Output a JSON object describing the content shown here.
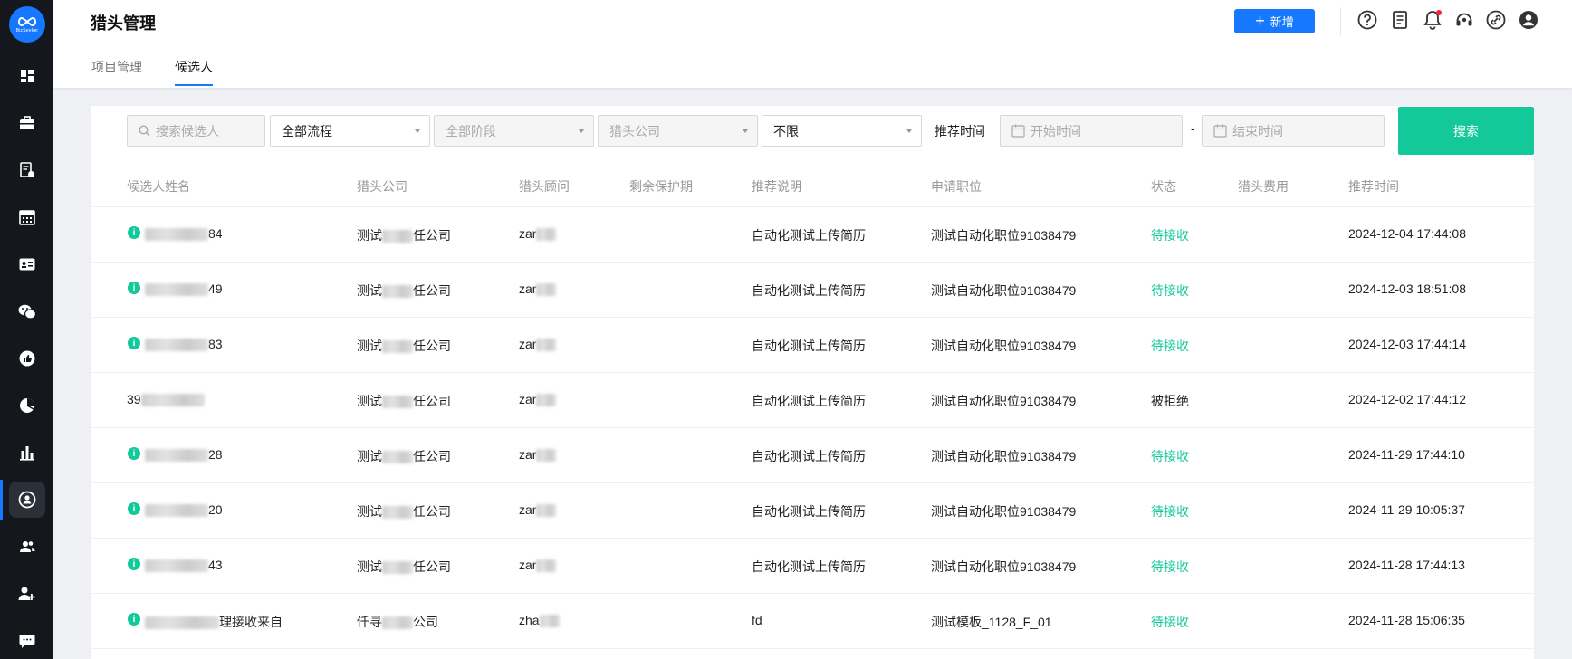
{
  "app": {
    "logo_text": "BizSeeker"
  },
  "header": {
    "title": "猎头管理",
    "add_label": "新增"
  },
  "tabs": [
    {
      "label": "项目管理",
      "active": false
    },
    {
      "label": "候选人",
      "active": true
    }
  ],
  "filters": {
    "search_placeholder": "搜索候选人",
    "process_value": "全部流程",
    "stage_placeholder": "全部阶段",
    "company_placeholder": "猎头公司",
    "limit_value": "不限",
    "time_label": "推荐时间",
    "start_placeholder": "开始时间",
    "dash": "-",
    "end_placeholder": "结束时间",
    "search_button": "搜索"
  },
  "table": {
    "columns": [
      "候选人姓名",
      "猎头公司",
      "猎头顾问",
      "剩余保护期",
      "推荐说明",
      "申请职位",
      "状态",
      "猎头费用",
      "推荐时间"
    ],
    "rows": [
      {
        "has_info": true,
        "name_suffix": "84",
        "company_pre": "测试",
        "company_post": "任公司",
        "consultant": "zar",
        "note": "自动化测试上传简历",
        "position": "测试自动化职位91038479",
        "status": "待接收",
        "fee": "",
        "time": "2024-12-04 17:44:08"
      },
      {
        "has_info": true,
        "name_suffix": "49",
        "company_pre": "测试",
        "company_post": "任公司",
        "consultant": "zar",
        "note": "自动化测试上传简历",
        "position": "测试自动化职位91038479",
        "status": "待接收",
        "fee": "",
        "time": "2024-12-03 18:51:08"
      },
      {
        "has_info": true,
        "name_suffix": "83",
        "company_pre": "测试",
        "company_post": "任公司",
        "consultant": "zar",
        "note": "自动化测试上传简历",
        "position": "测试自动化职位91038479",
        "status": "待接收",
        "fee": "",
        "time": "2024-12-03 17:44:14"
      },
      {
        "has_info": false,
        "name_prefix": "39",
        "company_pre": "测试",
        "company_post": "任公司",
        "consultant": "zar",
        "note": "自动化测试上传简历",
        "position": "测试自动化职位91038479",
        "status": "被拒绝",
        "fee": "",
        "time": "2024-12-02 17:44:12"
      },
      {
        "has_info": true,
        "name_suffix": "28",
        "company_pre": "测试",
        "company_post": "任公司",
        "consultant": "zar",
        "note": "自动化测试上传简历",
        "position": "测试自动化职位91038479",
        "status": "待接收",
        "fee": "",
        "time": "2024-11-29 17:44:10"
      },
      {
        "has_info": true,
        "name_suffix": "20",
        "company_pre": "测试",
        "company_post": "任公司",
        "consultant": "zar",
        "note": "自动化测试上传简历",
        "position": "测试自动化职位91038479",
        "status": "待接收",
        "fee": "",
        "time": "2024-11-29 10:05:37"
      },
      {
        "has_info": true,
        "name_suffix": "43",
        "company_pre": "测试",
        "company_post": "任公司",
        "consultant": "zar",
        "note": "自动化测试上传简历",
        "position": "测试自动化职位91038479",
        "status": "待接收",
        "fee": "",
        "time": "2024-11-28 17:44:13"
      },
      {
        "has_info": true,
        "name_suffix": "理接收来自",
        "company_pre": "仟寻",
        "company_post": "公司",
        "consultant": "zha",
        "note": "fd",
        "position": "测试模板_1128_F_01",
        "status": "待接收",
        "fee": "",
        "time": "2024-11-28 15:06:35"
      }
    ]
  },
  "colors": {
    "primary": "#1677ff",
    "accent": "#13c99a",
    "sidebar": "#14171c"
  },
  "sidebar_icons": [
    "dashboard-icon",
    "briefcase-icon",
    "resume-icon",
    "calendar-icon",
    "id-card-icon",
    "wechat-icon",
    "thumbs-up-icon",
    "pie-chart-icon",
    "bar-chart-icon",
    "headhunter-icon",
    "team-icon",
    "add-user-icon",
    "chat-icon"
  ]
}
